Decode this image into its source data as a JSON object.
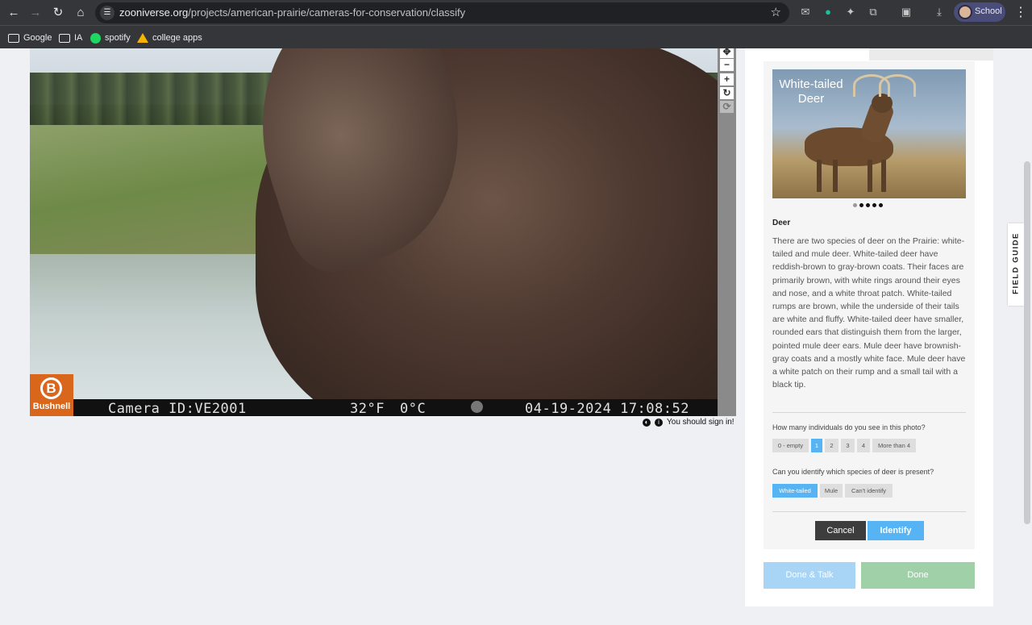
{
  "browser": {
    "url_host": "zooniverse.org",
    "url_path": "/projects/american-prairie/cameras-for-conservation/classify",
    "profile_label": "School",
    "bookmarks": [
      "Google",
      "IA",
      "spotify",
      "college apps"
    ]
  },
  "viewer": {
    "camera_brand": "Bushnell",
    "camera_logo_letter": "B",
    "camera_id": "Camera ID:VE2001",
    "temp_f": "32°F",
    "temp_c": "0°C",
    "datetime": "04-19-2024 17:08:52",
    "sign_in_notice": "You should sign in!"
  },
  "field_guide": {
    "tab_label": "FIELD GUIDE",
    "image_caption": "White-tailed Deer",
    "title": "Deer",
    "description": "There are two species of deer on the Prairie: white-tailed and mule deer. White-tailed deer have reddish-brown to gray-brown coats. Their faces are primarily brown, with white rings around their eyes and nose, and a white throat patch. White-tailed rumps are brown, while the underside of their tails are white and fluffy. White-tailed deer have smaller, rounded ears that distinguish them from the larger, pointed mule deer ears. Mule deer have brownish-gray coats and a mostly white face. Mule deer have a white patch on their rump and a small tail with a black tip."
  },
  "questions": {
    "count_question": "How many individuals do you see in this photo?",
    "count_options": [
      "0 - empty",
      "1",
      "2",
      "3",
      "4",
      "More than 4"
    ],
    "species_question": "Can you identify which species of deer is present?",
    "species_options": [
      "White-tailed",
      "Mule",
      "Can't identify"
    ]
  },
  "buttons": {
    "cancel": "Cancel",
    "identify": "Identify",
    "done_talk": "Done & Talk",
    "done": "Done"
  },
  "colors": {
    "accent": "#56b4f4",
    "logo": "#d9661b",
    "done_green": "#9fd0a8"
  }
}
